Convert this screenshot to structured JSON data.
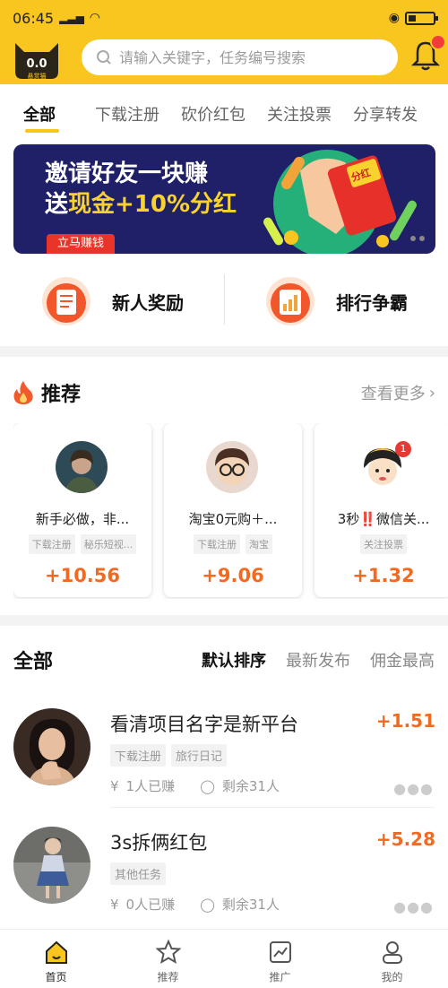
{
  "status": {
    "time": "06:45",
    "signal": "’’’’",
    "battery": ""
  },
  "header": {
    "logo_text": "0.0",
    "logo_sub": "悬赏猫",
    "search_placeholder": "请输入关键字，任务编号搜索"
  },
  "tabs": [
    "全部",
    "下载注册",
    "砍价红包",
    "关注投票",
    "分享转发"
  ],
  "banner": {
    "line1": "邀请好友一块赚",
    "line2_prefix": "送",
    "line2_highlight": "现金+10%分红",
    "cta": "立马赚钱",
    "tag": "分红"
  },
  "quick": [
    {
      "label": "新人奖励",
      "icon": "gift-card-icon"
    },
    {
      "label": "排行争霸",
      "icon": "leaderboard-icon"
    }
  ],
  "recommend": {
    "title": "推荐",
    "more": "查看更多",
    "cards": [
      {
        "title": "新手必做，非...",
        "tags": [
          "下载注册",
          "秘乐短视..."
        ],
        "price": "+10.56"
      },
      {
        "title": "淘宝0元购＋...",
        "tags": [
          "下载注册",
          "淘宝"
        ],
        "price": "+9.06"
      },
      {
        "title": "3秒‼️微信关...",
        "tags": [
          "关注投票"
        ],
        "price": "+1.32",
        "badge": "1"
      }
    ]
  },
  "all": {
    "title": "全部",
    "sorts": [
      "默认排序",
      "最新发布",
      "佣金最高"
    ],
    "tasks": [
      {
        "name": "看清项目名字是新平台",
        "reward": "+1.51",
        "tags": [
          "下载注册",
          "旅行日记"
        ],
        "earned": "1人已赚",
        "remain": "剩余31人"
      },
      {
        "name": "3s拆俩红包",
        "reward": "+5.28",
        "tags": [
          "其他任务"
        ],
        "earned": "0人已赚",
        "remain": "剩余31人"
      }
    ]
  },
  "nav": [
    "首页",
    "推荐",
    "推广",
    "我的"
  ],
  "colors": {
    "brand": "#f9c51f",
    "accent": "#f06a22"
  }
}
